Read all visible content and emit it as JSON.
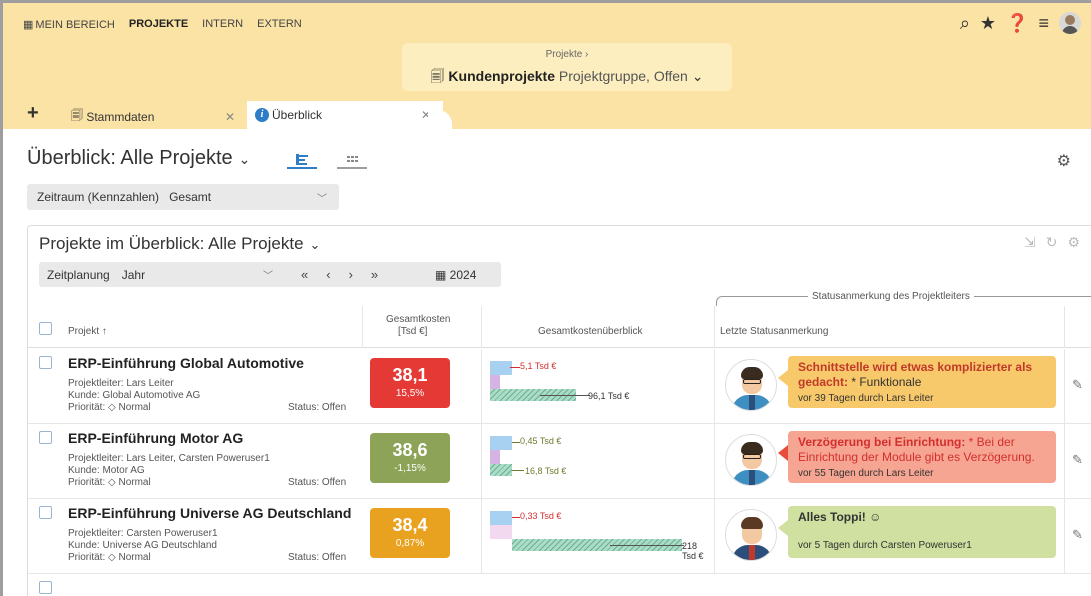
{
  "nav": {
    "items": [
      "MEIN BEREICH",
      "PROJEKTE",
      "INTERN",
      "EXTERN"
    ],
    "active": "PROJEKTE"
  },
  "project_box": {
    "breadcrumb": "Projekte  ›",
    "name": "Kundenprojekte",
    "subtitle": "Projektgruppe, Offen"
  },
  "tabs": [
    {
      "label": "Stammdaten"
    },
    {
      "label": "Überblick"
    }
  ],
  "page": {
    "title": "Überblick: Alle Projekte"
  },
  "filter": {
    "label": "Zeitraum (Kennzahlen)",
    "value": "Gesamt"
  },
  "panel": {
    "title": "Projekte im Überblick: Alle Projekte",
    "toolbar_label": "Zeitplanung",
    "toolbar_value": "Jahr",
    "year": "2024",
    "nav_first": "«",
    "nav_prev": "‹",
    "nav_next": "›",
    "nav_last": "»"
  },
  "columns": {
    "status_group": "Statusanmerkung des Projektleiters",
    "project": "Projekt ↑",
    "costs_line1": "Gesamtkosten",
    "costs_line2": "[Tsd €]",
    "overview": "Gesamtkostenüberblick",
    "last_status": "Letzte Statusanmerkung"
  },
  "rows": [
    {
      "name": "ERP-Einführung Global Automotive",
      "leader": "Projektleiter:  Lars Leiter",
      "customer": "Kunde:  Global Automotive AG",
      "priority": "Priorität:  ◇ Normal",
      "status": "Status:  Offen",
      "kpi_value": "38,1",
      "kpi_pct": "15,5%",
      "kpi_color": "#e53935",
      "mini_top": "5,1 Tsd €",
      "mini_bottom": "96,1 Tsd €",
      "mini_top_color": "#d32f2f",
      "bubble_bold": "Schnittstelle wird etwas komplizierter als gedacht:",
      "bubble_rest": " * Funktionale",
      "bubble_by": "vor 39 Tagen durch Lars Leiter",
      "bubble_bg": "#f8c96a",
      "bubble_color": "#c0392b"
    },
    {
      "name": "ERP-Einführung Motor AG",
      "leader": "Projektleiter:  Lars Leiter, Carsten Poweruser1",
      "customer": "Kunde:  Motor AG",
      "priority": "Priorität:  ◇ Normal",
      "status": "Status:  Offen",
      "kpi_value": "38,6",
      "kpi_pct": "-1,15%",
      "kpi_color": "#8da357",
      "mini_top": "0,45 Tsd €",
      "mini_bottom": "16,8 Tsd €",
      "mini_top_color": "#6b7d2e",
      "bubble_bold": "Verzögerung bei Einrichtung:",
      "bubble_rest": " * Bei der Einrichtung der Module gibt es Verzögerung.",
      "bubble_by": "vor 55 Tagen durch Lars Leiter",
      "bubble_bg": "#f6a592",
      "bubble_color": "#d32f2f"
    },
    {
      "name": "ERP-Einführung Universe AG Deutschland",
      "leader": "Projektleiter:  Carsten Poweruser1",
      "customer": "Kunde:  Universe AG Deutschland",
      "priority": "Priorität:  ◇ Normal",
      "status": "Status:  Offen",
      "kpi_value": "38,4",
      "kpi_pct": "0,87%",
      "kpi_color": "#e9a21f",
      "mini_top": "0,33 Tsd €",
      "mini_bottom": "218 Tsd €",
      "mini_top_color": "#d32f2f",
      "bubble_bold": "Alles Toppi!",
      "bubble_rest": " ☺",
      "bubble_by": "vor 5 Tagen durch Carsten Poweruser1",
      "bubble_bg": "#cfe0a0",
      "bubble_color": "#333333"
    }
  ]
}
